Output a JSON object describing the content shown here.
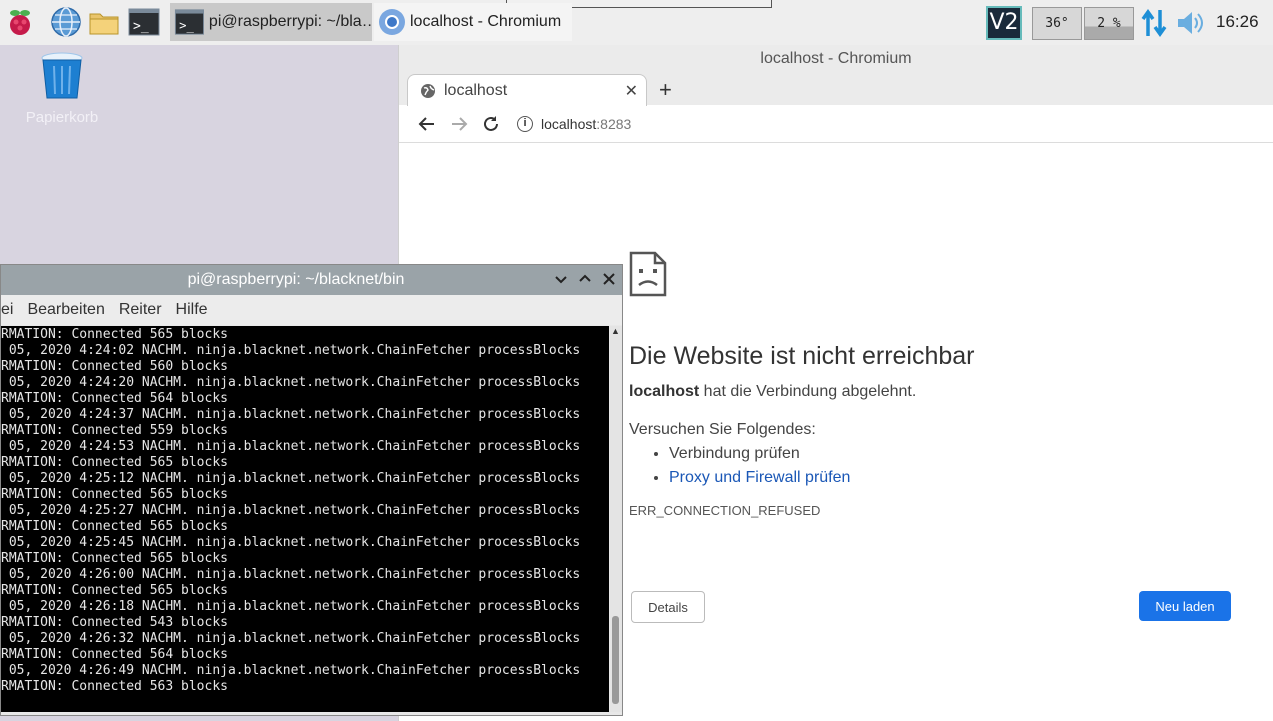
{
  "taskbar": {
    "tasks": [
      {
        "label": "pi@raspberrypi: ~/bla…"
      },
      {
        "label": "localhost - Chromium"
      }
    ],
    "ve_label": "V2",
    "cpu_temp": "36°",
    "cpu_usage": "2 %",
    "clock": "16:26"
  },
  "desktop": {
    "trash_label": "Papierkorb"
  },
  "chromium": {
    "window_title": "localhost - Chromium",
    "tab_title": "localhost",
    "url_host": "localhost",
    "url_port": ":8283",
    "error": {
      "title": "Die Website ist nicht erreichbar",
      "host": "localhost",
      "desc_rest": " hat die Verbindung abgelehnt.",
      "try_heading": "Versuchen Sie Folgendes:",
      "suggestions": [
        "Verbindung prüfen",
        "Proxy und Firewall prüfen"
      ],
      "code": "ERR_CONNECTION_REFUSED",
      "details_label": "Details",
      "reload_label": "Neu laden"
    }
  },
  "terminal": {
    "title": "pi@raspberrypi: ~/blacknet/bin",
    "menu": [
      "ei",
      "Bearbeiten",
      "Reiter",
      "Hilfe"
    ],
    "lines": [
      "RMATION: Connected 565 blocks",
      " 05, 2020 4:24:02 NACHM. ninja.blacknet.network.ChainFetcher processBlocks",
      "RMATION: Connected 560 blocks",
      " 05, 2020 4:24:20 NACHM. ninja.blacknet.network.ChainFetcher processBlocks",
      "RMATION: Connected 564 blocks",
      " 05, 2020 4:24:37 NACHM. ninja.blacknet.network.ChainFetcher processBlocks",
      "RMATION: Connected 559 blocks",
      " 05, 2020 4:24:53 NACHM. ninja.blacknet.network.ChainFetcher processBlocks",
      "RMATION: Connected 565 blocks",
      " 05, 2020 4:25:12 NACHM. ninja.blacknet.network.ChainFetcher processBlocks",
      "RMATION: Connected 565 blocks",
      " 05, 2020 4:25:27 NACHM. ninja.blacknet.network.ChainFetcher processBlocks",
      "RMATION: Connected 565 blocks",
      " 05, 2020 4:25:45 NACHM. ninja.blacknet.network.ChainFetcher processBlocks",
      "RMATION: Connected 565 blocks",
      " 05, 2020 4:26:00 NACHM. ninja.blacknet.network.ChainFetcher processBlocks",
      "RMATION: Connected 565 blocks",
      " 05, 2020 4:26:18 NACHM. ninja.blacknet.network.ChainFetcher processBlocks",
      "RMATION: Connected 543 blocks",
      " 05, 2020 4:26:32 NACHM. ninja.blacknet.network.ChainFetcher processBlocks",
      "RMATION: Connected 564 blocks",
      " 05, 2020 4:26:49 NACHM. ninja.blacknet.network.ChainFetcher processBlocks",
      "RMATION: Connected 563 blocks"
    ]
  },
  "colors": {
    "accent": "#1a73e8",
    "link": "#1a57b6",
    "terminal_bg": "#000000",
    "desktop_bg": "#d8d4e0"
  }
}
